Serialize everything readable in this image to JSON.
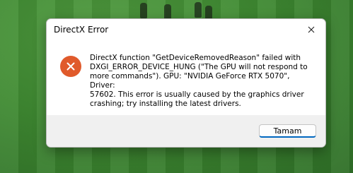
{
  "dialog": {
    "title": "DirectX Error",
    "message": "DirectX function \"GetDeviceRemovedReason\" failed with\nDXGI_ERROR_DEVICE_HUNG (\"The GPU will not respond to\nmore commands\"). GPU: \"NVIDIA GeForce RTX 5070\", Driver:\n57602. This error is usually caused by the graphics driver\ncrashing; try installing the latest drivers.",
    "ok_label": "Tamam",
    "icon": "error-icon",
    "close_icon": "close-icon"
  },
  "colors": {
    "error_icon": "#e05a2b",
    "button_accent": "#0067c0",
    "footer_bg": "#f0f0f0",
    "background_field": "#3f8a32"
  }
}
